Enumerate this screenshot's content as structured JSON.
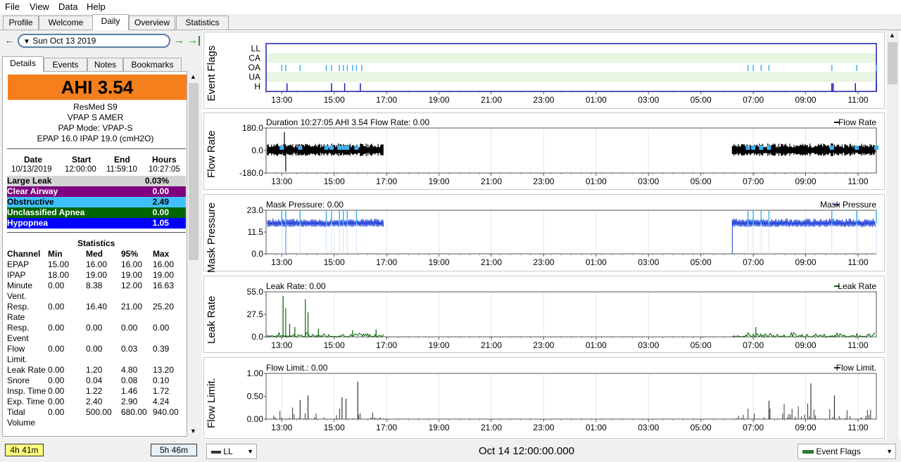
{
  "menu": [
    "File",
    "View",
    "Data",
    "Help"
  ],
  "main_tabs": [
    "Profile",
    "Welcome",
    "Daily",
    "Overview",
    "Statistics"
  ],
  "nav": {
    "date": "Sun Oct 13 2019"
  },
  "sub_tabs": [
    "Details",
    "Events",
    "Notes",
    "Bookmarks"
  ],
  "summary": {
    "ahi": "AHI 3.54",
    "machine": "ResMed S9",
    "model": "VPAP S AMER",
    "pap_mode": "PAP Mode: VPAP-S",
    "pressure": "EPAP 16.0 IPAP 19.0 (cmH2O)"
  },
  "session": {
    "headers": [
      "Date",
      "Start",
      "End",
      "Hours"
    ],
    "values": [
      "10/13/2019",
      "12:00:00",
      "11:59:10",
      "10:27:05"
    ]
  },
  "events": [
    {
      "name": "Large Leak",
      "value": "0.03%",
      "color": "#d3d3d3",
      "text": "#000000"
    },
    {
      "name": "Clear Airway",
      "value": "0.00",
      "color": "#800080",
      "text": "#ffffff"
    },
    {
      "name": "Obstructive",
      "value": "2.49",
      "color": "#40c0ff",
      "text": "#000000"
    },
    {
      "name": "Unclassified Apnea",
      "value": "0.00",
      "color": "#006400",
      "text": "#ffffff"
    },
    {
      "name": "Hypopnea",
      "value": "1.05",
      "color": "#0000ff",
      "text": "#ffffff"
    }
  ],
  "statistics": {
    "title": "Statistics",
    "headers": [
      "Channel",
      "Min",
      "Med",
      "95%",
      "Max"
    ],
    "rows": [
      {
        "ch": [
          "EPAP"
        ],
        "vals": [
          "15.00",
          "16.00",
          "16.00",
          "16.00"
        ]
      },
      {
        "ch": [
          "IPAP"
        ],
        "vals": [
          "18.00",
          "19.00",
          "19.00",
          "19.00"
        ]
      },
      {
        "ch": [
          "Minute",
          "Vent."
        ],
        "vals": [
          "0.00",
          "8.38",
          "12.00",
          "16.63"
        ]
      },
      {
        "ch": [
          "Resp.",
          "Rate"
        ],
        "vals": [
          "0.00",
          "16.40",
          "21.00",
          "25.20"
        ]
      },
      {
        "ch": [
          "Resp.",
          "Event"
        ],
        "vals": [
          "0.00",
          "0.00",
          "0.00",
          "0.00"
        ]
      },
      {
        "ch": [
          "Flow",
          "Limit."
        ],
        "vals": [
          "0.00",
          "0.00",
          "0.03",
          "0.39"
        ]
      },
      {
        "ch": [
          "Leak Rate"
        ],
        "vals": [
          "0.00",
          "1.20",
          "4.80",
          "13.20"
        ]
      },
      {
        "ch": [
          "Snore"
        ],
        "vals": [
          "0.00",
          "0.04",
          "0.08",
          "0.10"
        ]
      },
      {
        "ch": [
          "Insp. Time"
        ],
        "vals": [
          "0.00",
          "1.22",
          "1.46",
          "1.72"
        ]
      },
      {
        "ch": [
          "Exp. Time"
        ],
        "vals": [
          "0.00",
          "2.40",
          "2.90",
          "4.24"
        ]
      },
      {
        "ch": [
          "Tidal",
          "Volume"
        ],
        "vals": [
          "0.00",
          "500.00",
          "680.00",
          "940.00"
        ]
      }
    ]
  },
  "time_left": "4h 41m",
  "time_right": "5h 46m",
  "xticks": [
    "13:00",
    "15:00",
    "17:00",
    "19:00",
    "21:00",
    "23:00",
    "01:00",
    "03:00",
    "05:00",
    "07:00",
    "09:00",
    "11:00"
  ],
  "graphs": {
    "event_flags": {
      "title": "Event Flags",
      "labels": [
        "LL",
        "CA",
        "OA",
        "UA",
        "H"
      ]
    },
    "flow_rate": {
      "title": "Flow Rate",
      "info": "Duration 10:27:05 AHI 3.54 Flow Rate: 0.00",
      "legend": "Flow Rate",
      "yticks": [
        "180.0",
        "0.0",
        "-180.0"
      ],
      "color": "#000000"
    },
    "mask_pressure": {
      "title": "Mask Pressure",
      "info": "Mask Pressure: 0.00",
      "legend": "Mask Pressure",
      "yticks": [
        "23.0",
        "11.5",
        "0.0"
      ],
      "color": "#1f3fd8"
    },
    "leak_rate": {
      "title": "Leak Rate",
      "info": "Leak Rate: 0.00",
      "legend": "Leak Rate",
      "yticks": [
        "55.0",
        "27.5",
        "0.0"
      ],
      "color": "#006400"
    },
    "flow_limit": {
      "title": "Flow Limit.",
      "info": "Flow Limit.: 0.00",
      "legend": "Flow Limit.",
      "yticks": [
        "1.00",
        "0.50",
        "0.00"
      ],
      "color": "#333333"
    }
  },
  "bottom": {
    "left_combo": "LL",
    "center": "Oct 14 12:00:00.000",
    "right_combo": "Event Flags"
  }
}
